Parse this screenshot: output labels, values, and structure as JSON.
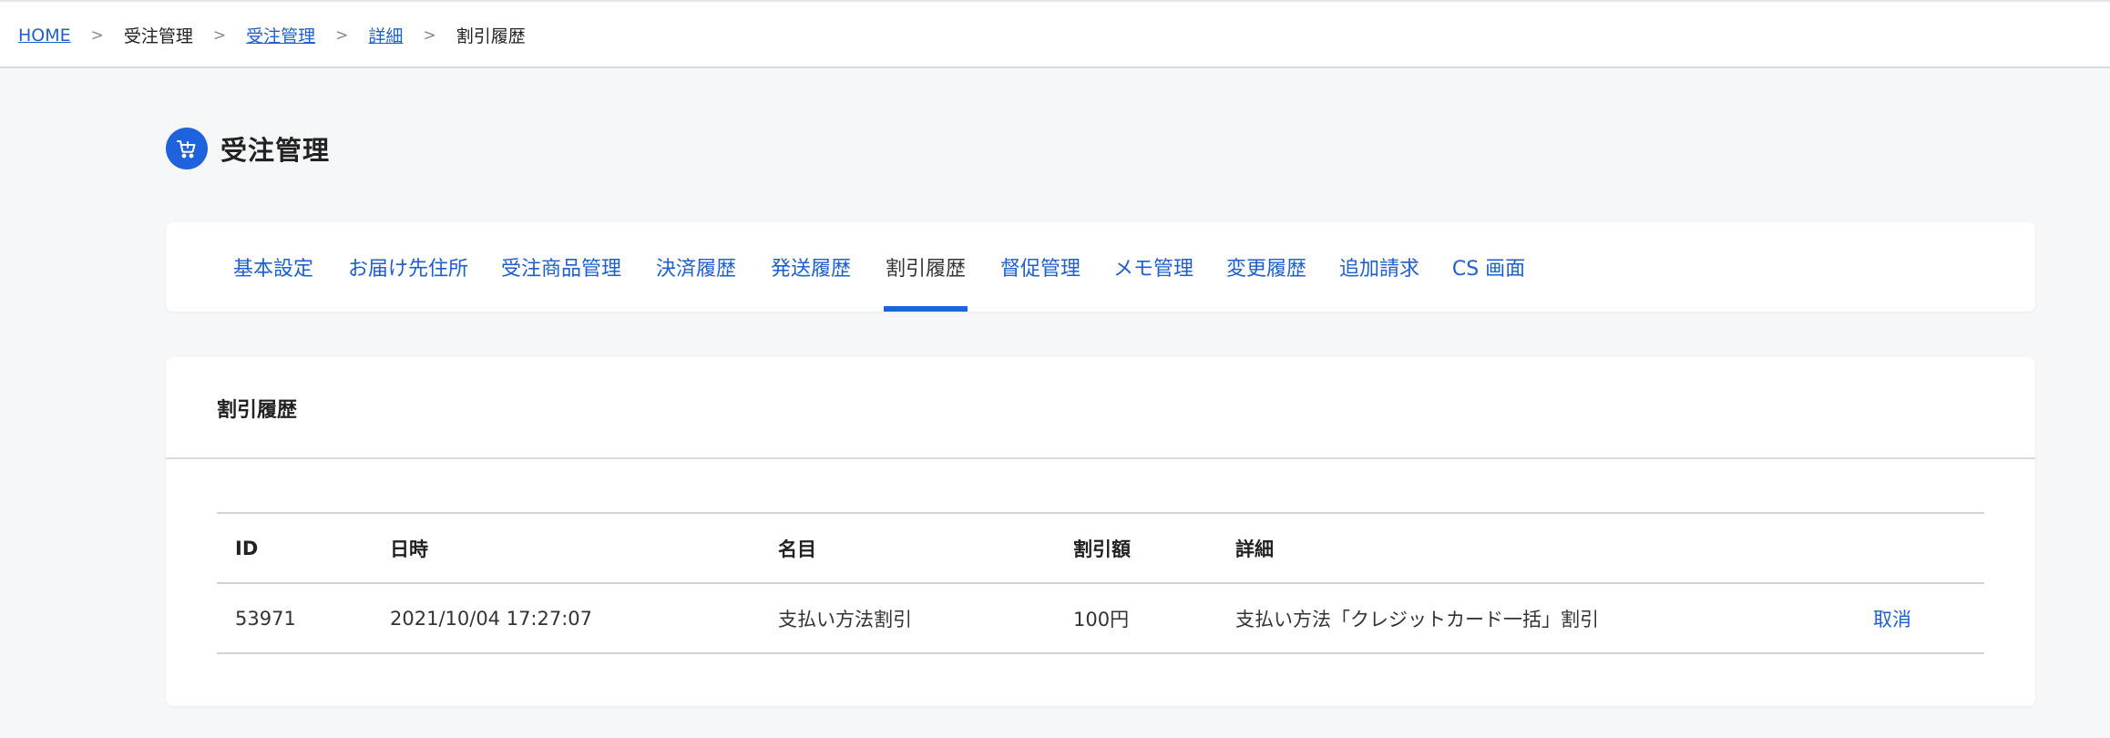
{
  "breadcrumb": [
    {
      "label": "HOME",
      "link": true
    },
    {
      "label": "受注管理",
      "link": false
    },
    {
      "label": "受注管理",
      "link": true
    },
    {
      "label": "詳細",
      "link": true
    },
    {
      "label": "割引履歴",
      "link": false
    }
  ],
  "breadcrumb_separator": ">",
  "page": {
    "title": "受注管理",
    "icon": "shopping-cart-icon"
  },
  "tabs": [
    {
      "label": "基本設定"
    },
    {
      "label": "お届け先住所"
    },
    {
      "label": "受注商品管理"
    },
    {
      "label": "決済履歴"
    },
    {
      "label": "発送履歴"
    },
    {
      "label": "割引履歴",
      "active": true
    },
    {
      "label": "督促管理"
    },
    {
      "label": "メモ管理"
    },
    {
      "label": "変更履歴"
    },
    {
      "label": "追加請求"
    },
    {
      "label": "CS 画面"
    }
  ],
  "history": {
    "title": "割引履歴",
    "columns": {
      "id": "ID",
      "datetime": "日時",
      "name": "名目",
      "amount": "割引額",
      "detail": "詳細"
    },
    "rows": [
      {
        "id": "53971",
        "datetime": "2021/10/04 17:27:07",
        "name": "支払い方法割引",
        "amount": "100円",
        "detail": "支払い方法「クレジットカード一括」割引",
        "action": "取消"
      }
    ]
  },
  "colors": {
    "accent": "#1e63dd",
    "link": "#1d5fd0",
    "background": "#f6f7f8"
  }
}
